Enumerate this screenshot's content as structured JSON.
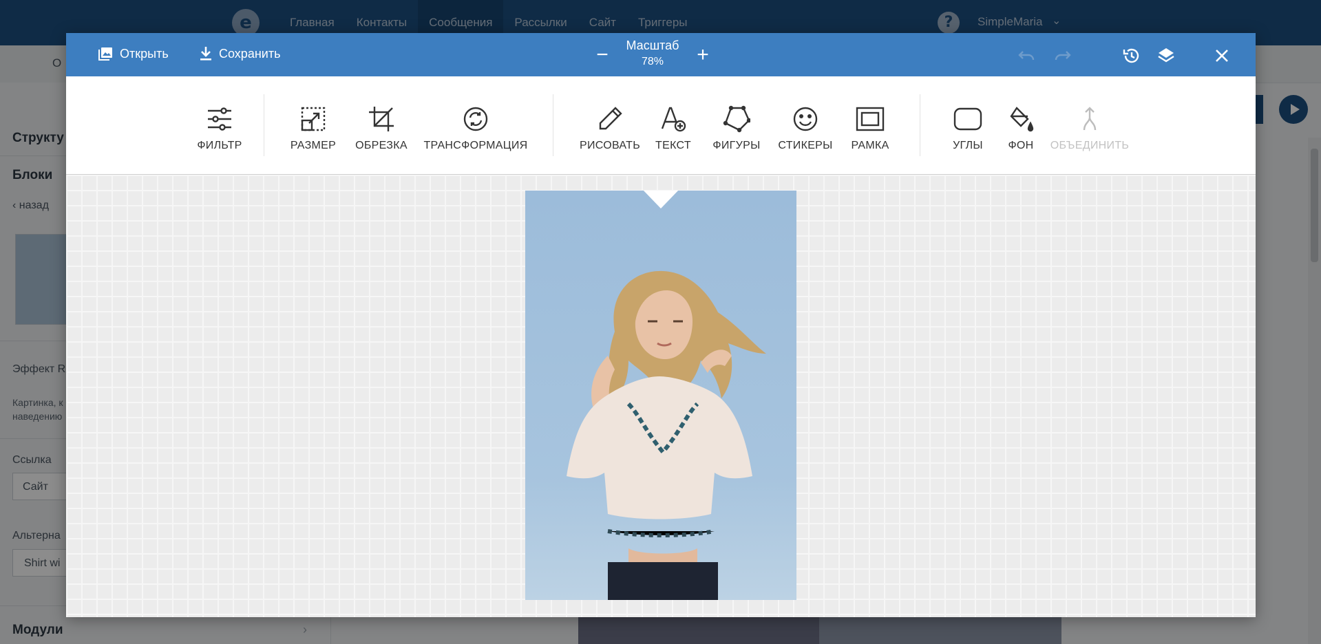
{
  "app": {
    "nav": [
      "Главная",
      "Контакты",
      "Сообщения",
      "Рассылки",
      "Сайт",
      "Триггеры"
    ],
    "nav_active": "Сообщения",
    "user": "SimpleMaria",
    "help": "?",
    "logo": "e"
  },
  "sidebar": {
    "structure": "Структу",
    "blocks": "Блоки",
    "back": "назад",
    "effect_label": "Эффект R",
    "desc_line1": "Картинка, к",
    "desc_line2": "наведению",
    "link_label": "Ссылка",
    "link_select": "Сайт",
    "alt_label": "Альтерна",
    "alt_value": "Shirt wi",
    "modules": "Модули",
    "tab_partial": "О"
  },
  "editor": {
    "open_label": "Открыть",
    "save_label": "Сохранить",
    "zoom_label": "Масштаб",
    "zoom_value": "78%",
    "zoom_out": "−",
    "zoom_in": "+",
    "tools": [
      {
        "label": "ФИЛЬТР",
        "icon": "filter-icon"
      },
      {
        "label": "РАЗМЕР",
        "icon": "resize-icon"
      },
      {
        "label": "ОБРЕЗКА",
        "icon": "crop-icon"
      },
      {
        "label": "ТРАНСФОРМАЦИЯ",
        "icon": "transform-icon"
      },
      {
        "label": "РИСОВАТЬ",
        "icon": "pencil-icon"
      },
      {
        "label": "ТЕКСТ",
        "icon": "text-icon"
      },
      {
        "label": "ФИГУРЫ",
        "icon": "shapes-icon"
      },
      {
        "label": "СТИКЕРЫ",
        "icon": "sticker-icon"
      },
      {
        "label": "РАМКА",
        "icon": "frame-icon"
      },
      {
        "label": "УГЛЫ",
        "icon": "corners-icon"
      },
      {
        "label": "ФОН",
        "icon": "paint-bucket-icon"
      },
      {
        "label": "ОБЪЕДИНИТЬ",
        "icon": "merge-icon",
        "disabled": true
      }
    ]
  },
  "colors": {
    "header_blue": "#3d7ec0",
    "nav_blue": "#1d4f80"
  }
}
